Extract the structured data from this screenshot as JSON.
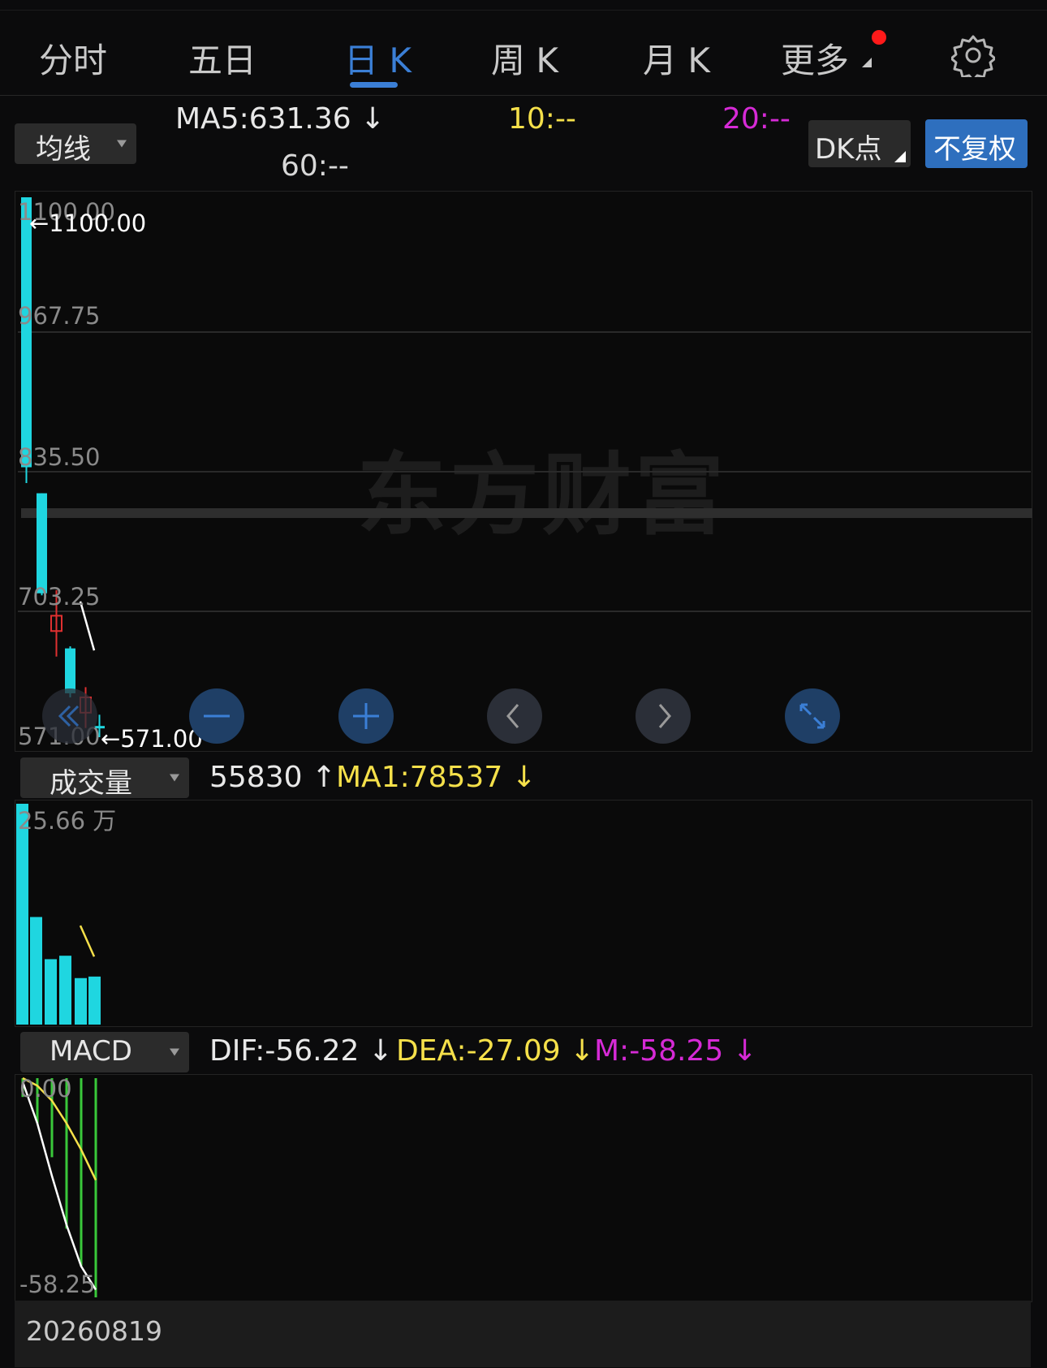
{
  "tabs": [
    {
      "label": "分时"
    },
    {
      "label": "五日"
    },
    {
      "label": "日 K"
    },
    {
      "label": "周 K"
    },
    {
      "label": "月 K"
    },
    {
      "label": "更多"
    }
  ],
  "active_tab_index": 2,
  "settings_icon": "gear-icon",
  "indicator": {
    "ma_dropdown": "均线",
    "ma5": "MA5:631.36 ↓",
    "ma10": "10:--",
    "ma20": "20:--",
    "ma60": "60:--",
    "dk_button": "DK点",
    "adjust_button": "不复权"
  },
  "colors": {
    "bg": "#0b0b0c",
    "accent_blue": "#3b7fd6",
    "down_cyan": "#1fd6e0",
    "up_red": "#e03030",
    "ma10_yellow": "#f5e04a",
    "ma20_magenta": "#d62ad6",
    "macd_green": "#39c83a"
  },
  "price_chart": {
    "y_ticks": [
      "1100.00",
      "967.75",
      "835.50",
      "703.25",
      "571.00"
    ],
    "max_label": "←1100.00",
    "min_label": "←571.00",
    "watermark": "东方财富",
    "controls": [
      {
        "name": "rewind-icon"
      },
      {
        "name": "zoom-out-icon"
      },
      {
        "name": "zoom-in-icon"
      },
      {
        "name": "scroll-left-icon"
      },
      {
        "name": "scroll-right-icon"
      },
      {
        "name": "expand-icon"
      }
    ]
  },
  "volume": {
    "dropdown": "成交量",
    "value": "55830 ↑",
    "ma1": "MA1:78537 ↓",
    "y_top": "25.66 万"
  },
  "macd": {
    "dropdown": "MACD",
    "dif": "DIF:-56.22 ↓",
    "dea": "DEA:-27.09 ↓",
    "m": "M:-58.25 ↓",
    "y_top": "0.00",
    "y_bottom": "-58.25"
  },
  "footer": {
    "date": "20260819"
  },
  "chart_data": {
    "type": "candlestick",
    "candles": [
      {
        "open": 1100.0,
        "close": 835.5,
        "high": 1100.0,
        "low": 820.0,
        "dir": "down"
      },
      {
        "open": 810.0,
        "close": 712.0,
        "high": 810.0,
        "low": 710.0,
        "dir": "down"
      },
      {
        "open": 675.0,
        "close": 690.0,
        "high": 715.0,
        "low": 650.0,
        "dir": "up"
      },
      {
        "open": 658.0,
        "close": 614.0,
        "high": 660.0,
        "low": 610.0,
        "dir": "down"
      },
      {
        "open": 595.0,
        "close": 610.0,
        "high": 620.0,
        "low": 580.0,
        "dir": "up"
      },
      {
        "open": 582.0,
        "close": 580.0,
        "high": 593.0,
        "low": 571.0,
        "dir": "down"
      }
    ],
    "ma5_line": [
      [
        5,
        704
      ],
      [
        6,
        656
      ]
    ],
    "ylim": [
      571.0,
      1100.0
    ],
    "volume_values_wan": [
      25.66,
      12.5,
      7.6,
      8.0,
      5.4,
      5.58
    ],
    "volume_ma1": [
      [
        5,
        11.5
      ],
      [
        6,
        7.9
      ]
    ],
    "volume_ylim": [
      0,
      25.66
    ],
    "macd_bars": [
      -5,
      -12,
      -21,
      -40,
      -50,
      -58.25
    ],
    "macd_dif": [
      -1,
      -12,
      -26,
      -39,
      -50,
      -56.22
    ],
    "macd_dea": [
      0,
      -2,
      -6,
      -12,
      -19,
      -27.09
    ],
    "macd_ylim": [
      -58.25,
      0
    ]
  }
}
